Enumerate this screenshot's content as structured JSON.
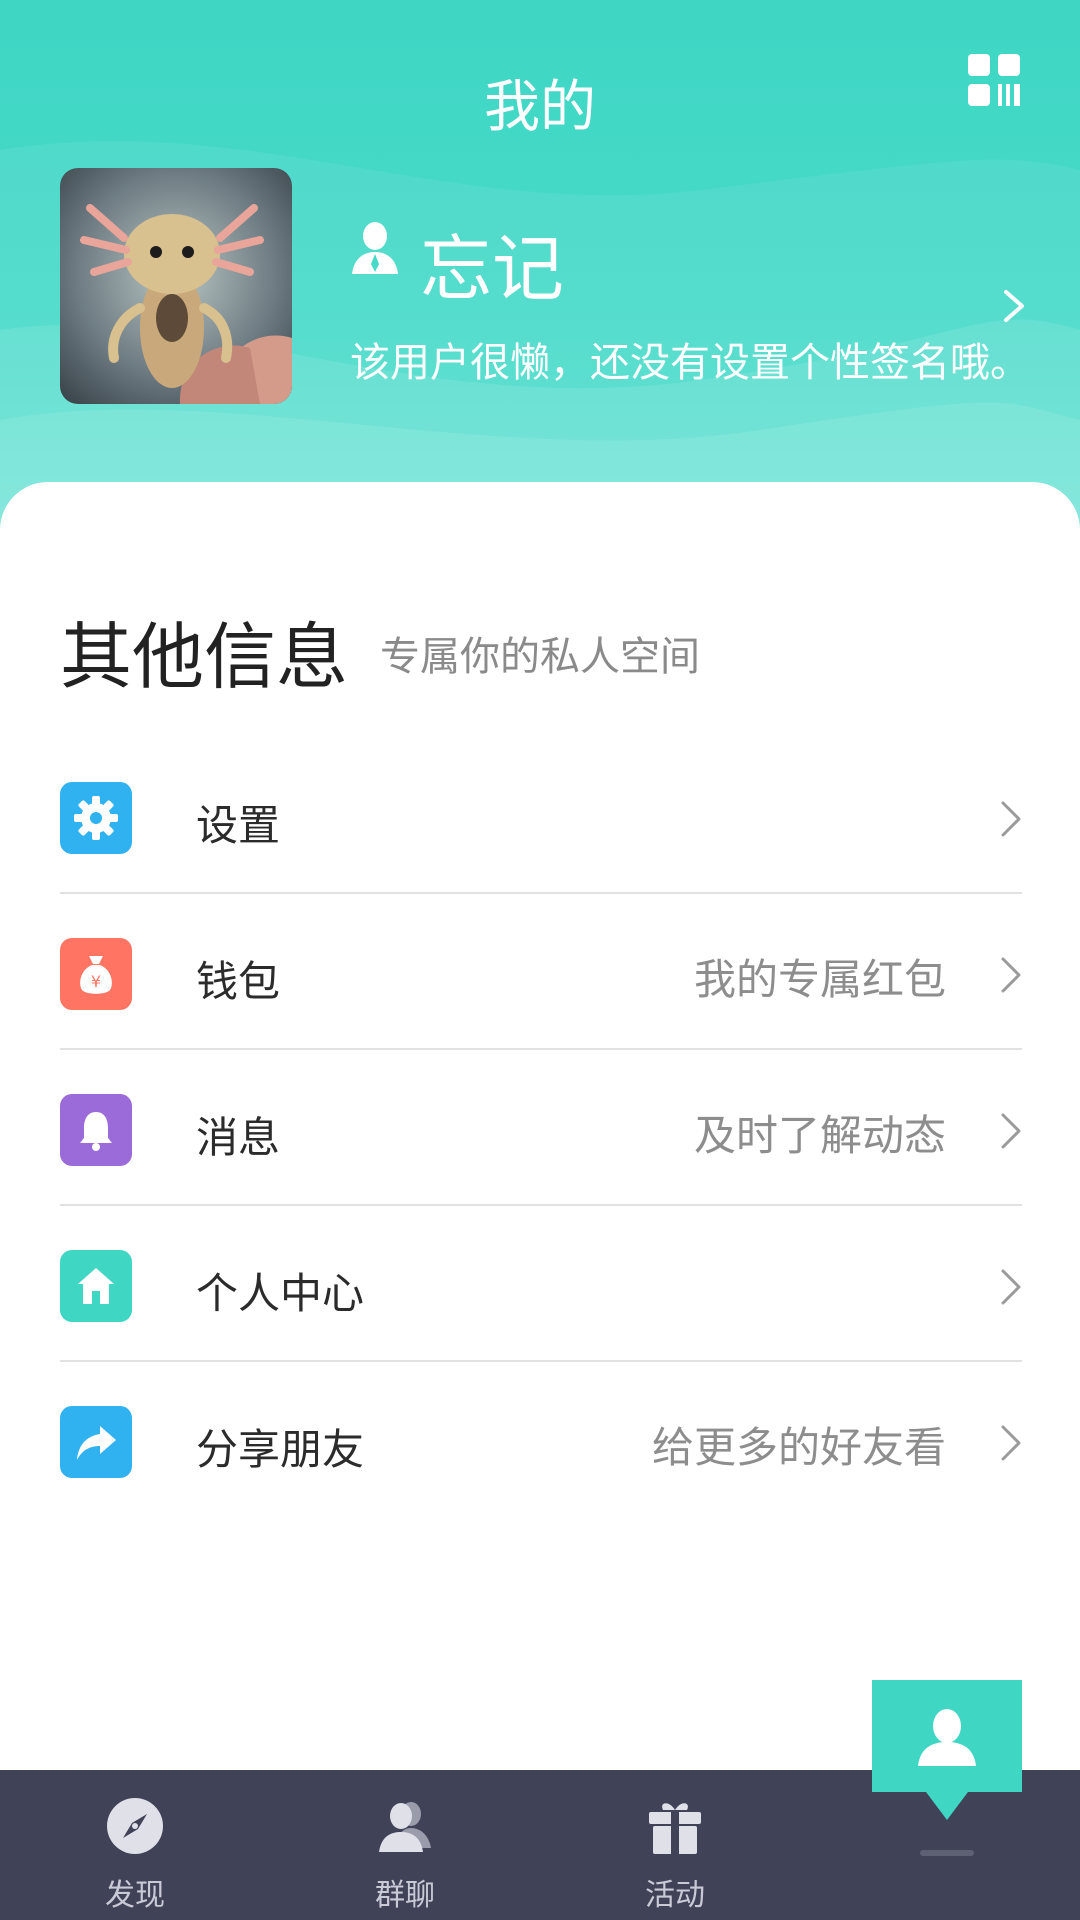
{
  "header": {
    "title": "我的",
    "user": {
      "name": "忘记",
      "signature": "该用户很懒，还没有设置个性签名哦。"
    }
  },
  "section": {
    "title": "其他信息",
    "subtitle": "专属你的私人空间"
  },
  "menu": [
    {
      "label": "设置",
      "hint": "",
      "icon": "gear-icon",
      "color": "#2fb2ef"
    },
    {
      "label": "钱包",
      "hint": "我的专属红包",
      "icon": "money-bag-icon",
      "color": "#ff7463"
    },
    {
      "label": "消息",
      "hint": "及时了解动态",
      "icon": "bell-icon",
      "color": "#9a6bd9"
    },
    {
      "label": "个人中心",
      "hint": "",
      "icon": "home-icon",
      "color": "#3fd6c4"
    },
    {
      "label": "分享朋友",
      "hint": "给更多的好友看",
      "icon": "share-icon",
      "color": "#2fb2ef"
    }
  ],
  "tabbar": {
    "tabs": [
      {
        "label": "发现",
        "icon": "compass-icon"
      },
      {
        "label": "群聊",
        "icon": "people-icon"
      },
      {
        "label": "活动",
        "icon": "gift-icon"
      },
      {
        "label": "",
        "icon": "user-icon",
        "active": true
      }
    ],
    "active_color": "#3fd6c4",
    "background": "#404258"
  }
}
